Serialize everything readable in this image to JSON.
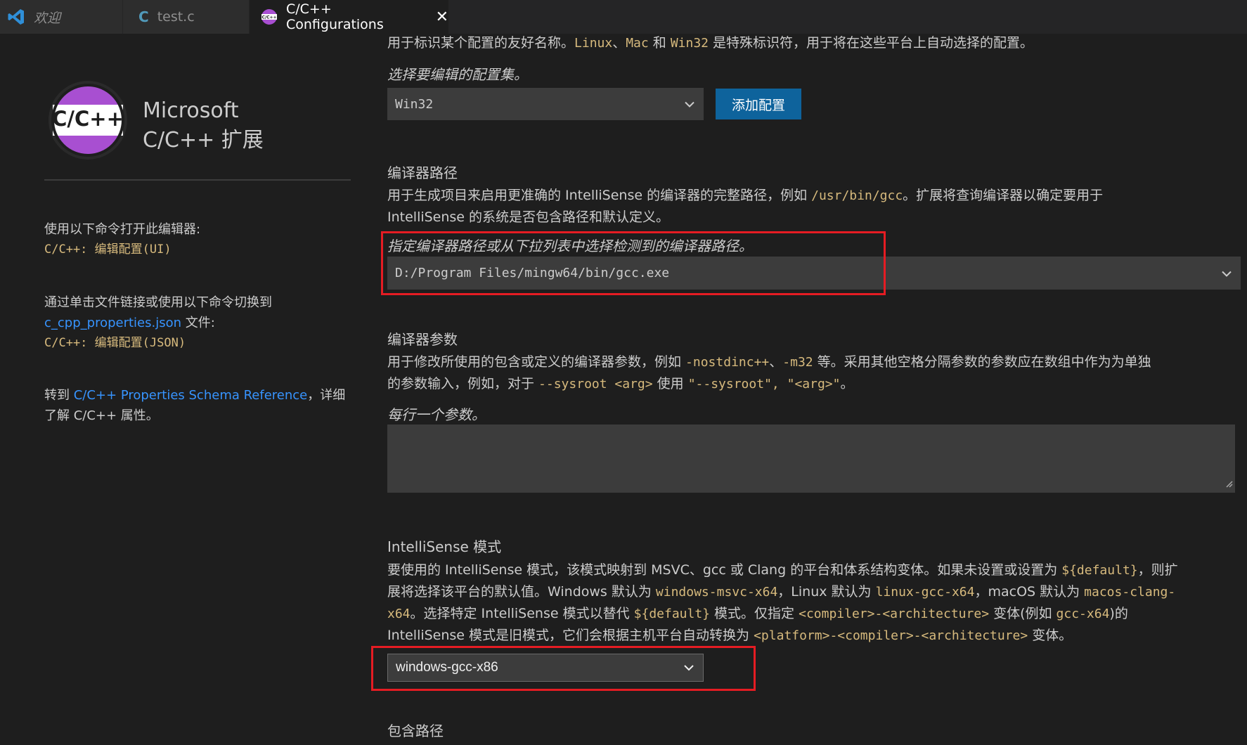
{
  "tabs": [
    {
      "label": "欢迎",
      "icon": "vscode-logo-icon"
    },
    {
      "label": "test.c",
      "icon": "c-file-icon",
      "icon_text": "C"
    },
    {
      "label": "C/C++ Configurations",
      "icon": "cpp-extension-icon",
      "close": "✕"
    }
  ],
  "sidebar": {
    "logo_text": "C/C++",
    "brand_line1": "Microsoft",
    "brand_line2": "C/C++ 扩展",
    "open_cmd_text": "使用以下命令打开此编辑器:",
    "open_cmd": "C/C++: 编辑配置(UI)",
    "switch_text": "通过单击文件链接或使用以下命令切换到",
    "switch_link": "c_cpp_properties.json",
    "switch_suffix": " 文件:",
    "switch_cmd": "C/C++: 编辑配置(JSON)",
    "goto_prefix": "转到 ",
    "goto_link": "C/C++ Properties Schema Reference",
    "goto_suffix1": "，详细",
    "goto_suffix2": "了解 C/C++ 属性。"
  },
  "config_name": {
    "desc_a": "用于标识某个配置的友好名称。",
    "code_linux": "Linux",
    "sep1": "、",
    "code_mac": "Mac",
    "and": " 和 ",
    "code_win32": "Win32",
    "desc_b": " 是特殊标识符，用于将在这些平台上自动选择的配置。",
    "select_hint": "选择要编辑的配置集。",
    "select_value": "Win32",
    "add_button": "添加配置"
  },
  "compiler_path": {
    "heading": "编译器路径",
    "desc_a": "用于生成项目来启用更准确的 IntelliSense 的编译器的完整路径，例如 ",
    "code_gcc": "/usr/bin/gcc",
    "desc_b": "。扩展将查询编译器以确定要用于",
    "desc_c": "IntelliSense 的系统是否包含路径和默认定义。",
    "hint": "指定编译器路径或从下拉列表中选择检测到的编译器路径。",
    "value": "D:/Program Files/mingw64/bin/gcc.exe"
  },
  "compiler_args": {
    "heading": "编译器参数",
    "desc_a": "用于修改所使用的包含或定义的编译器参数，例如 ",
    "code_nostdinc": "-nostdinc++",
    "sep1": "、",
    "code_m32": "-m32",
    "desc_b": " 等。采用其他空格分隔参数的参数应在数组中作为为单独",
    "desc_c": "的参数输入，例如，对于 ",
    "code_sysroot": "--sysroot <arg>",
    "desc_d": " 使用 ",
    "code_sysroot_q": "\"--sysroot\"",
    "comma": ", ",
    "code_arg_q": "\"<arg>\"",
    "desc_e": "。",
    "hint": "每行一个参数。",
    "value": ""
  },
  "intellisense": {
    "heading": "IntelliSense 模式",
    "l1_a": "要使用的 IntelliSense 模式，该模式映射到 MSVC、gcc 或 Clang 的平台和体系结构变体。如果未设置或设置为 ",
    "l1_code": "${default}",
    "l1_b": "，则扩",
    "l2_a": "展将选择该平台的默认值。Windows 默认为 ",
    "l2_code1": "windows-msvc-x64",
    "l2_b": "，Linux 默认为 ",
    "l2_code2": "linux-gcc-x64",
    "l2_c": "，macOS 默认为 ",
    "l2_code3": "macos-clang-",
    "l3_code1": "x64",
    "l3_a": "。选择特定 IntelliSense 模式以替代 ",
    "l3_code2": "${default}",
    "l3_b": " 模式。仅指定 ",
    "l3_code3": "<compiler>-<architecture>",
    "l3_c": " 变体(例如 ",
    "l3_code4": "gcc-x64",
    "l3_d": ")的",
    "l4_a": "IntelliSense 模式是旧模式，它们会根据主机平台自动转换为 ",
    "l4_code": "<platform>-<compiler>-<architecture>",
    "l4_b": " 变体。",
    "value": "windows-gcc-x86"
  },
  "include_path": {
    "heading": "包含路径"
  },
  "colors": {
    "background": "#1e1e1e",
    "code": "#d7ba7d",
    "link": "#3794ff",
    "button": "#0e639c",
    "highlight_box": "#e51c23",
    "logo_purple": "#a84fd1"
  }
}
